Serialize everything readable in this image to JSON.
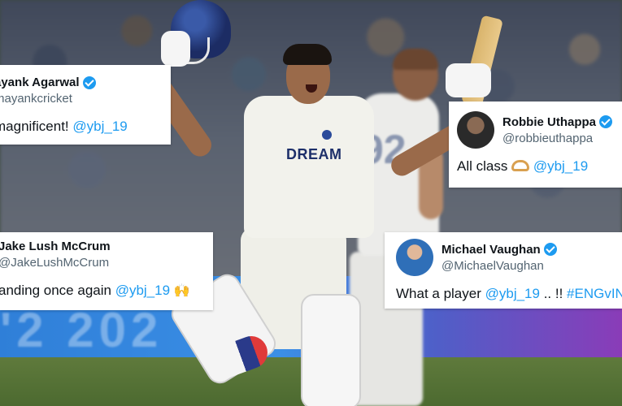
{
  "background": {
    "banner_text": "'2 202",
    "player_sponsor": "DREAM",
    "bg_player_number": "92"
  },
  "tweets": [
    {
      "name": "ayank Agarwal",
      "verified": true,
      "handle": "mayankcricket",
      "text_before": "magnificent! ",
      "mention": "@ybj_19",
      "text_after": ""
    },
    {
      "name": "Robbie Uthappa",
      "verified": true,
      "handle": "@robbieuthappa",
      "avatar_icon": "avatar-robbie",
      "text_before": "All class ",
      "emoji": "heart-hands-emoji",
      "mention": "@ybj_19",
      "text_after": ""
    },
    {
      "name": "Jake Lush McCrum",
      "verified": false,
      "handle": "@JakeLushMcCrum",
      "text_before": "anding once again ",
      "mention": "@ybj_19",
      "emoji_text": "🙌"
    },
    {
      "name": "Michael Vaughan",
      "verified": true,
      "handle": "@MichaelVaughan",
      "avatar_icon": "avatar-vaughan",
      "text_before": "What a player ",
      "mention": "@ybj_19",
      "text_middle": " .. !! ",
      "hashtag": "#ENGvIN"
    }
  ],
  "colors": {
    "mention": "#1d9bf0",
    "verified": "#1d9bf0",
    "handle": "#536471"
  }
}
